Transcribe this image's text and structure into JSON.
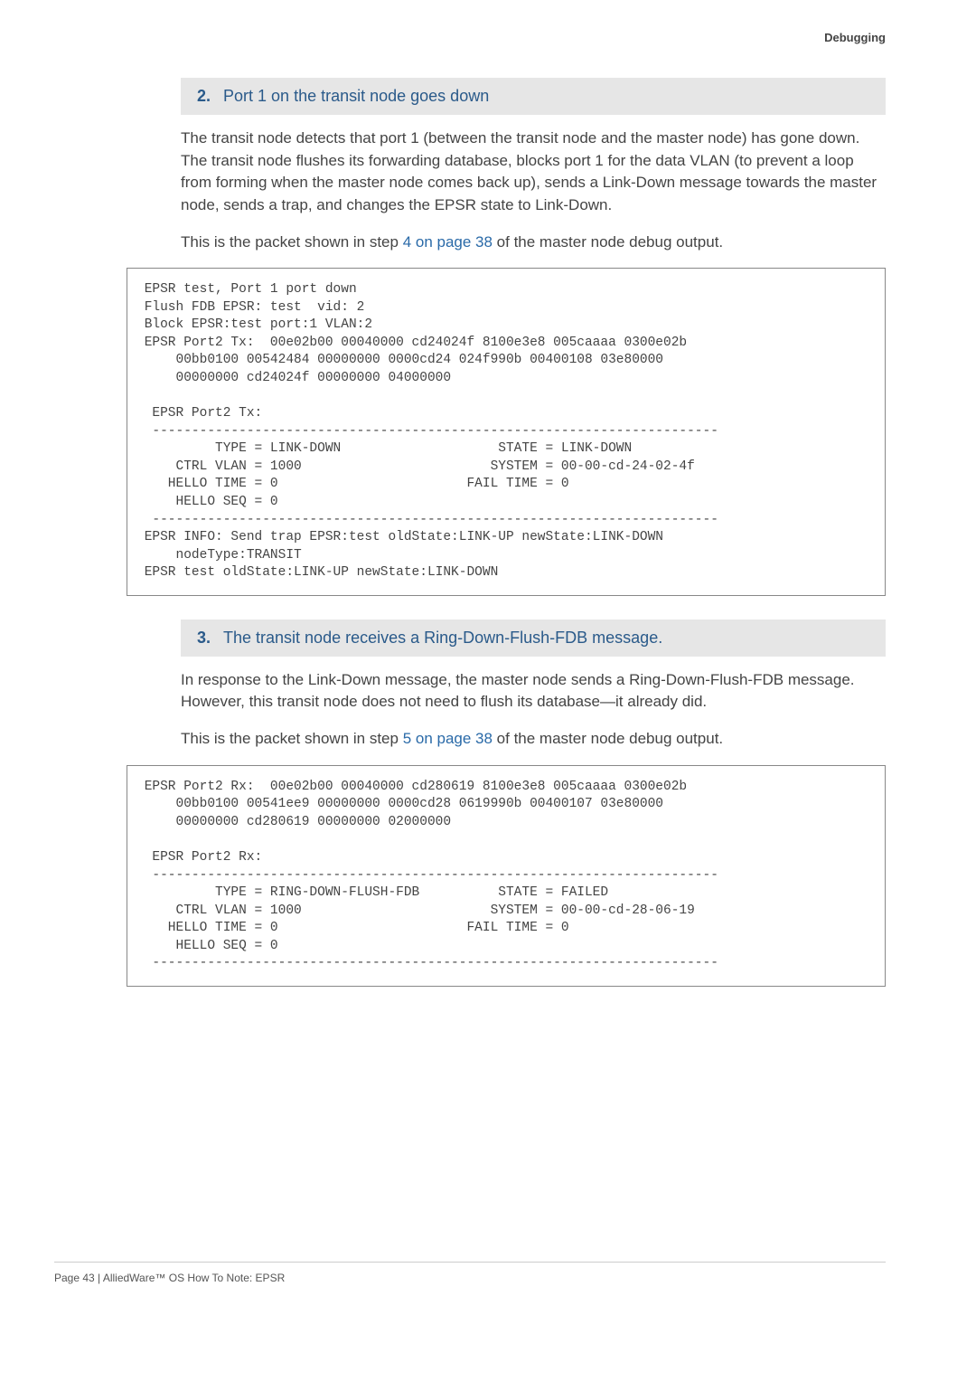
{
  "header": {
    "section": "Debugging"
  },
  "step2": {
    "num": "2.",
    "title": "Port 1 on the transit node goes down",
    "para1": "The transit node detects that port 1 (between the transit node and the master node) has gone down. The transit node flushes its forwarding database, blocks port 1 for the data VLAN (to prevent a loop from forming when the master node comes back up), sends a Link-Down message towards the master node, sends a trap, and changes the EPSR state to Link-Down.",
    "para2_a": "This is the packet shown in step ",
    "para2_link": "4 on page 38",
    "para2_b": " of the master node debug output.",
    "code": " EPSR test, Port 1 port down\n Flush FDB EPSR: test  vid: 2\n Block EPSR:test port:1 VLAN:2\n EPSR Port2 Tx:  00e02b00 00040000 cd24024f 8100e3e8 005caaaa 0300e02b\n     00bb0100 00542484 00000000 0000cd24 024f990b 00400108 03e80000\n     00000000 cd24024f 00000000 04000000\n\n  EPSR Port2 Tx:\n  ------------------------------------------------------------------------\n          TYPE = LINK-DOWN                    STATE = LINK-DOWN\n     CTRL VLAN = 1000                        SYSTEM = 00-00-cd-24-02-4f\n    HELLO TIME = 0                        FAIL TIME = 0\n     HELLO SEQ = 0\n  ------------------------------------------------------------------------\n EPSR INFO: Send trap EPSR:test oldState:LINK-UP newState:LINK-DOWN\n     nodeType:TRANSIT\n EPSR test oldState:LINK-UP newState:LINK-DOWN"
  },
  "step3": {
    "num": "3.",
    "title": "The transit node receives a Ring-Down-Flush-FDB message.",
    "para1": "In response to the Link-Down message, the master node sends a Ring-Down-Flush-FDB message. However, this transit node does not need to flush its database—it already did.",
    "para2_a": "This is the packet shown in step ",
    "para2_link": "5 on page 38",
    "para2_b": " of the master node debug output.",
    "code": " EPSR Port2 Rx:  00e02b00 00040000 cd280619 8100e3e8 005caaaa 0300e02b\n     00bb0100 00541ee9 00000000 0000cd28 0619990b 00400107 03e80000\n     00000000 cd280619 00000000 02000000\n\n  EPSR Port2 Rx:\n  ------------------------------------------------------------------------\n          TYPE = RING-DOWN-FLUSH-FDB          STATE = FAILED\n     CTRL VLAN = 1000                        SYSTEM = 00-00-cd-28-06-19\n    HELLO TIME = 0                        FAIL TIME = 0\n     HELLO SEQ = 0\n  ------------------------------------------------------------------------"
  },
  "footer": {
    "text": "Page 43 | AlliedWare™ OS How To Note: EPSR"
  }
}
